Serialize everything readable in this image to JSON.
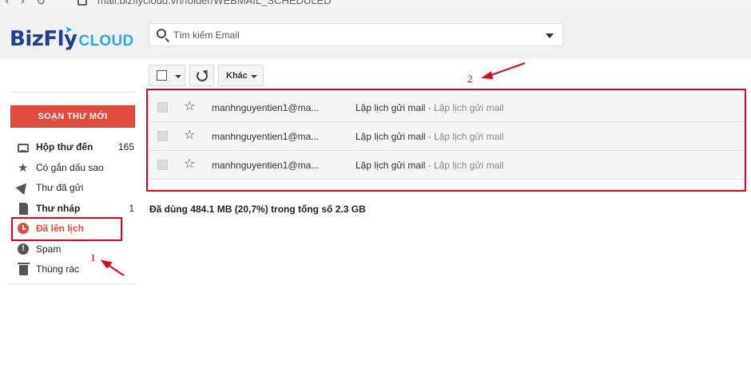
{
  "browser": {
    "url": "mail.bizflycloud.vn/folder/WEBMAIL_SCHEDULED"
  },
  "logo": {
    "brand": "BizFly",
    "suffix": "CLOUD"
  },
  "search": {
    "placeholder": "Tìm kiếm Email"
  },
  "toolbar": {
    "more_label": "Khác"
  },
  "sidebar": {
    "compose_label": "SOẠN THƯ MỚI",
    "items": [
      {
        "label": "Hộp thư đến",
        "count": "165",
        "icon": "inbox-icon",
        "bold": true
      },
      {
        "label": "Có gắn dấu sao",
        "count": "",
        "icon": "star-icon"
      },
      {
        "label": "Thư đã gửi",
        "count": "",
        "icon": "send-icon"
      },
      {
        "label": "Thư nháp",
        "count": "1",
        "icon": "draft-icon",
        "bold": true
      },
      {
        "label": "Đã lên lịch",
        "count": "",
        "icon": "clock-icon",
        "active": true
      },
      {
        "label": "Spam",
        "count": "",
        "icon": "spam-icon"
      },
      {
        "label": "Thùng rác",
        "count": "",
        "icon": "trash-icon"
      }
    ]
  },
  "mails": [
    {
      "sender": "manhnguyentien1@ma...",
      "subject": "Lập lịch gửi mail",
      "snippet": " - Lập lịch gửi mail"
    },
    {
      "sender": "manhnguyentien1@ma...",
      "subject": "Lập lịch gửi mail",
      "snippet": " - Lập lịch gửi mail"
    },
    {
      "sender": "manhnguyentien1@ma...",
      "subject": "Lập lịch gửi mail",
      "snippet": " - Lập lịch gửi mail"
    }
  ],
  "storage_text": "Đã dùng 484.1 MB (20,7%) trong tổng số 2.3 GB",
  "annotations": {
    "label_1": "1",
    "label_2": "2",
    "color": "#e0001b"
  },
  "colors": {
    "accent": "#e34b3c",
    "brand_dark": "#1f3f8f",
    "brand_light": "#29a9e1"
  }
}
